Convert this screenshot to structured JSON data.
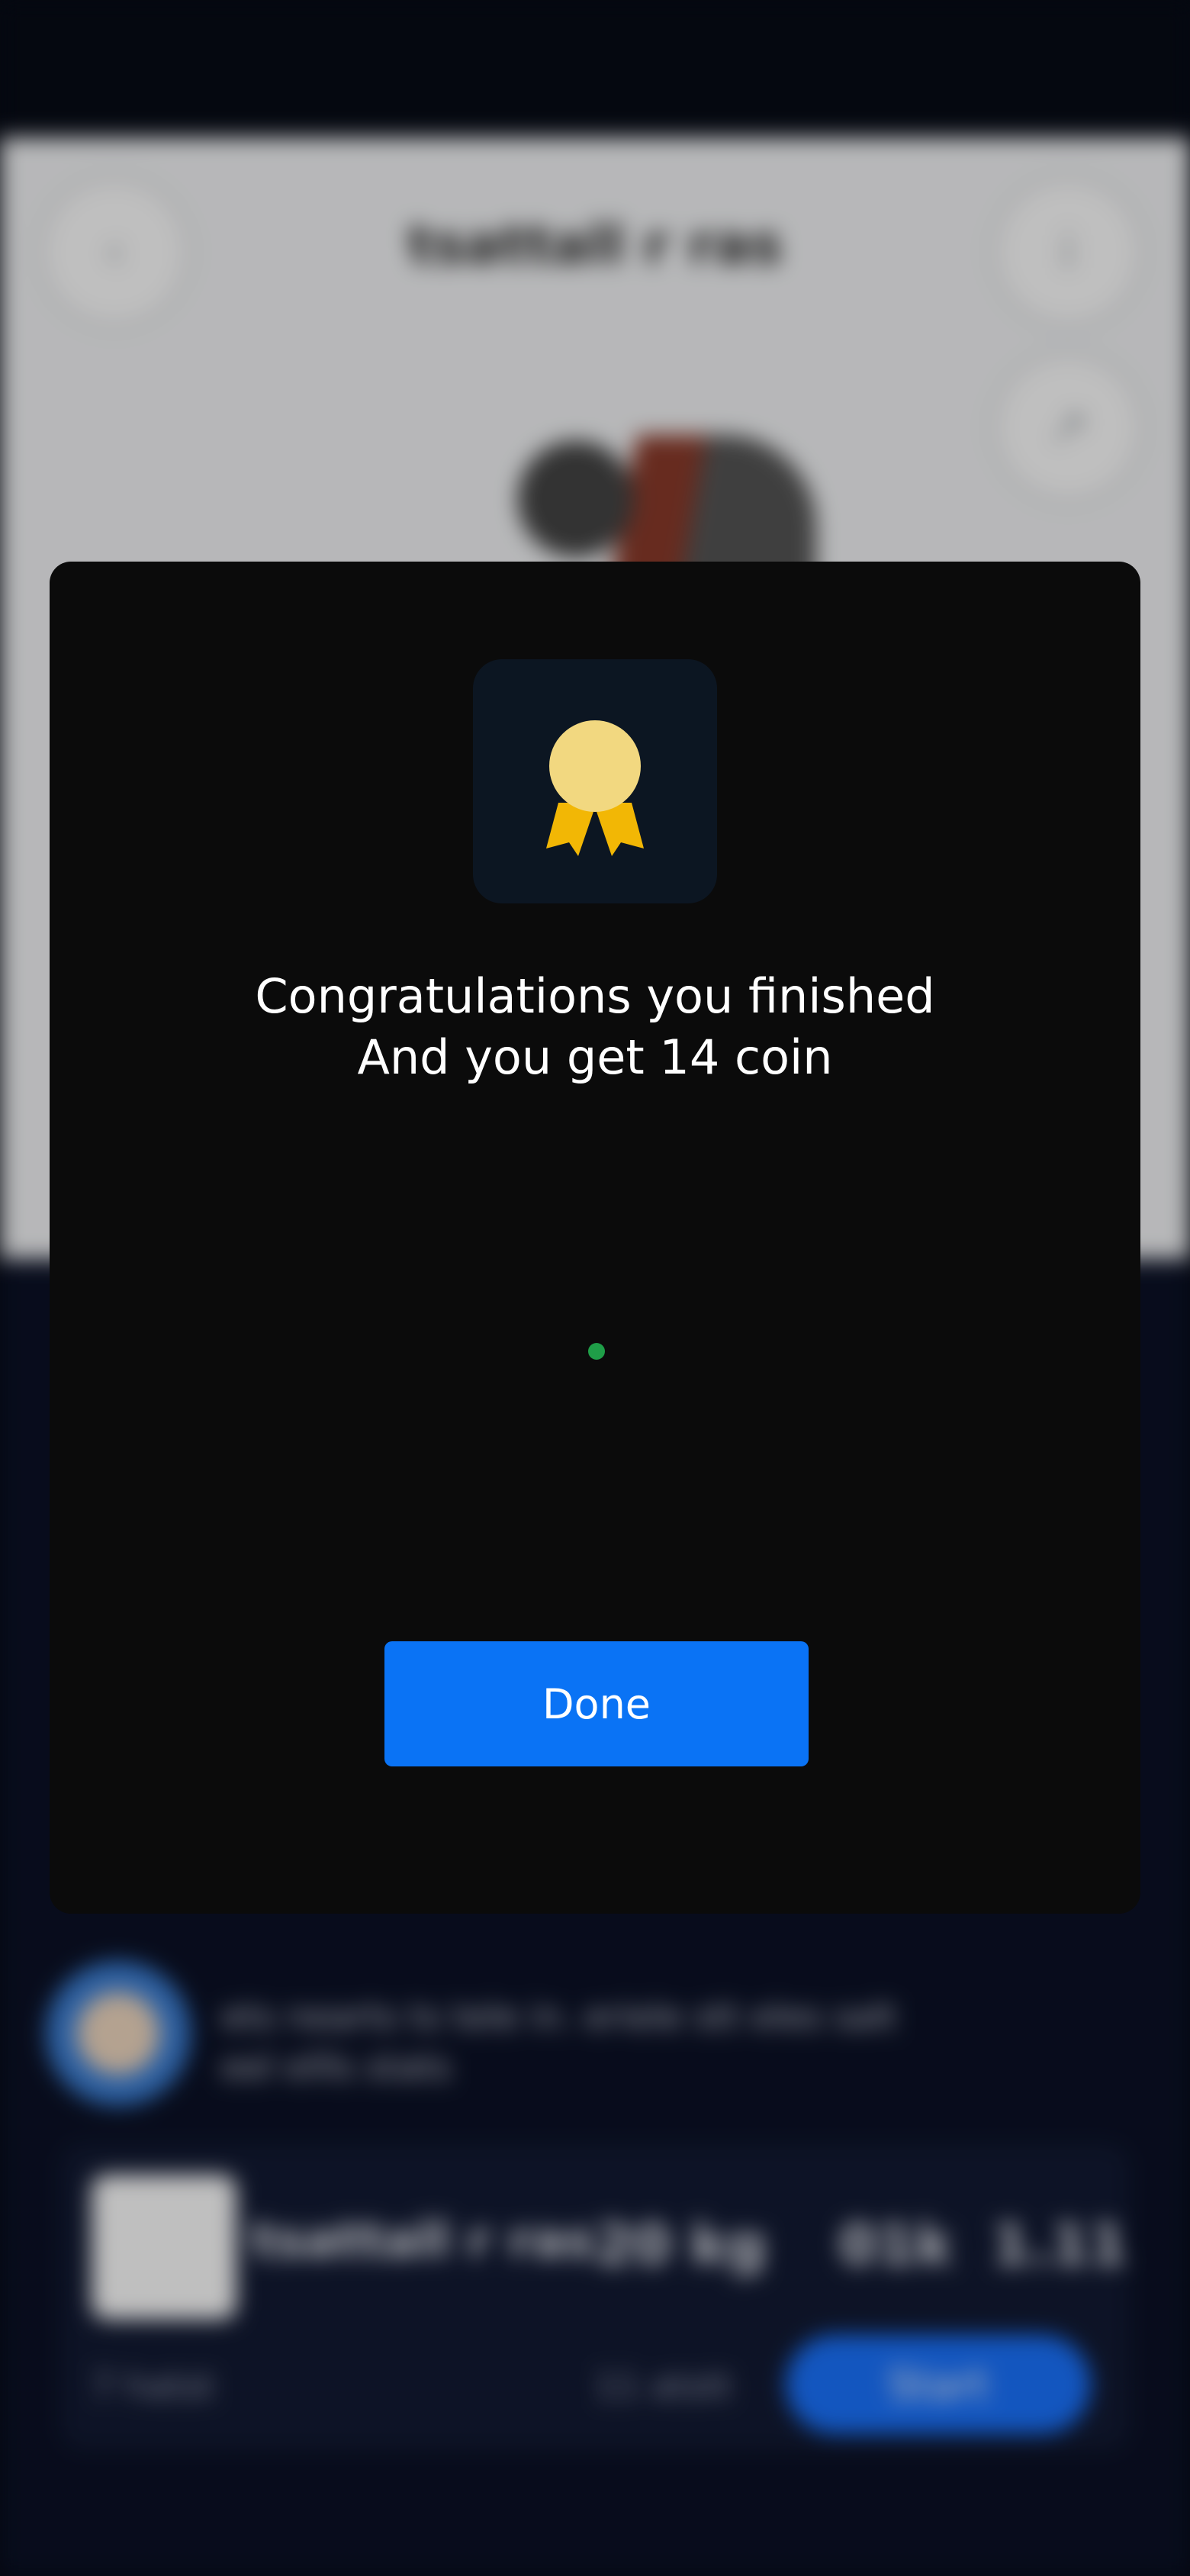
{
  "background": {
    "page_title": "tsattall r ras",
    "review_text": "ets nearts ts tele in. eriele stt eles salt eel ellls stats",
    "product": {
      "name": "tsattall r ras",
      "stat_1": "20 kg",
      "stat_2": "01k",
      "stat_3": "1.11",
      "meta": "7 hatst",
      "meta_2": "11 atstt",
      "button_label": "Start"
    }
  },
  "dialog": {
    "icon": "award-medal-icon",
    "message_line_1": "Congratulations you finished",
    "message_line_2": "And you get 14 coin",
    "done_label": "Done",
    "colors": {
      "dialog_bg": "#0b0b0b",
      "badge_bg": "#0c1622",
      "medal": "#f2d880",
      "ribbon": "#f2b705",
      "button": "#0a73f5",
      "loader": "#1f9e48"
    }
  }
}
